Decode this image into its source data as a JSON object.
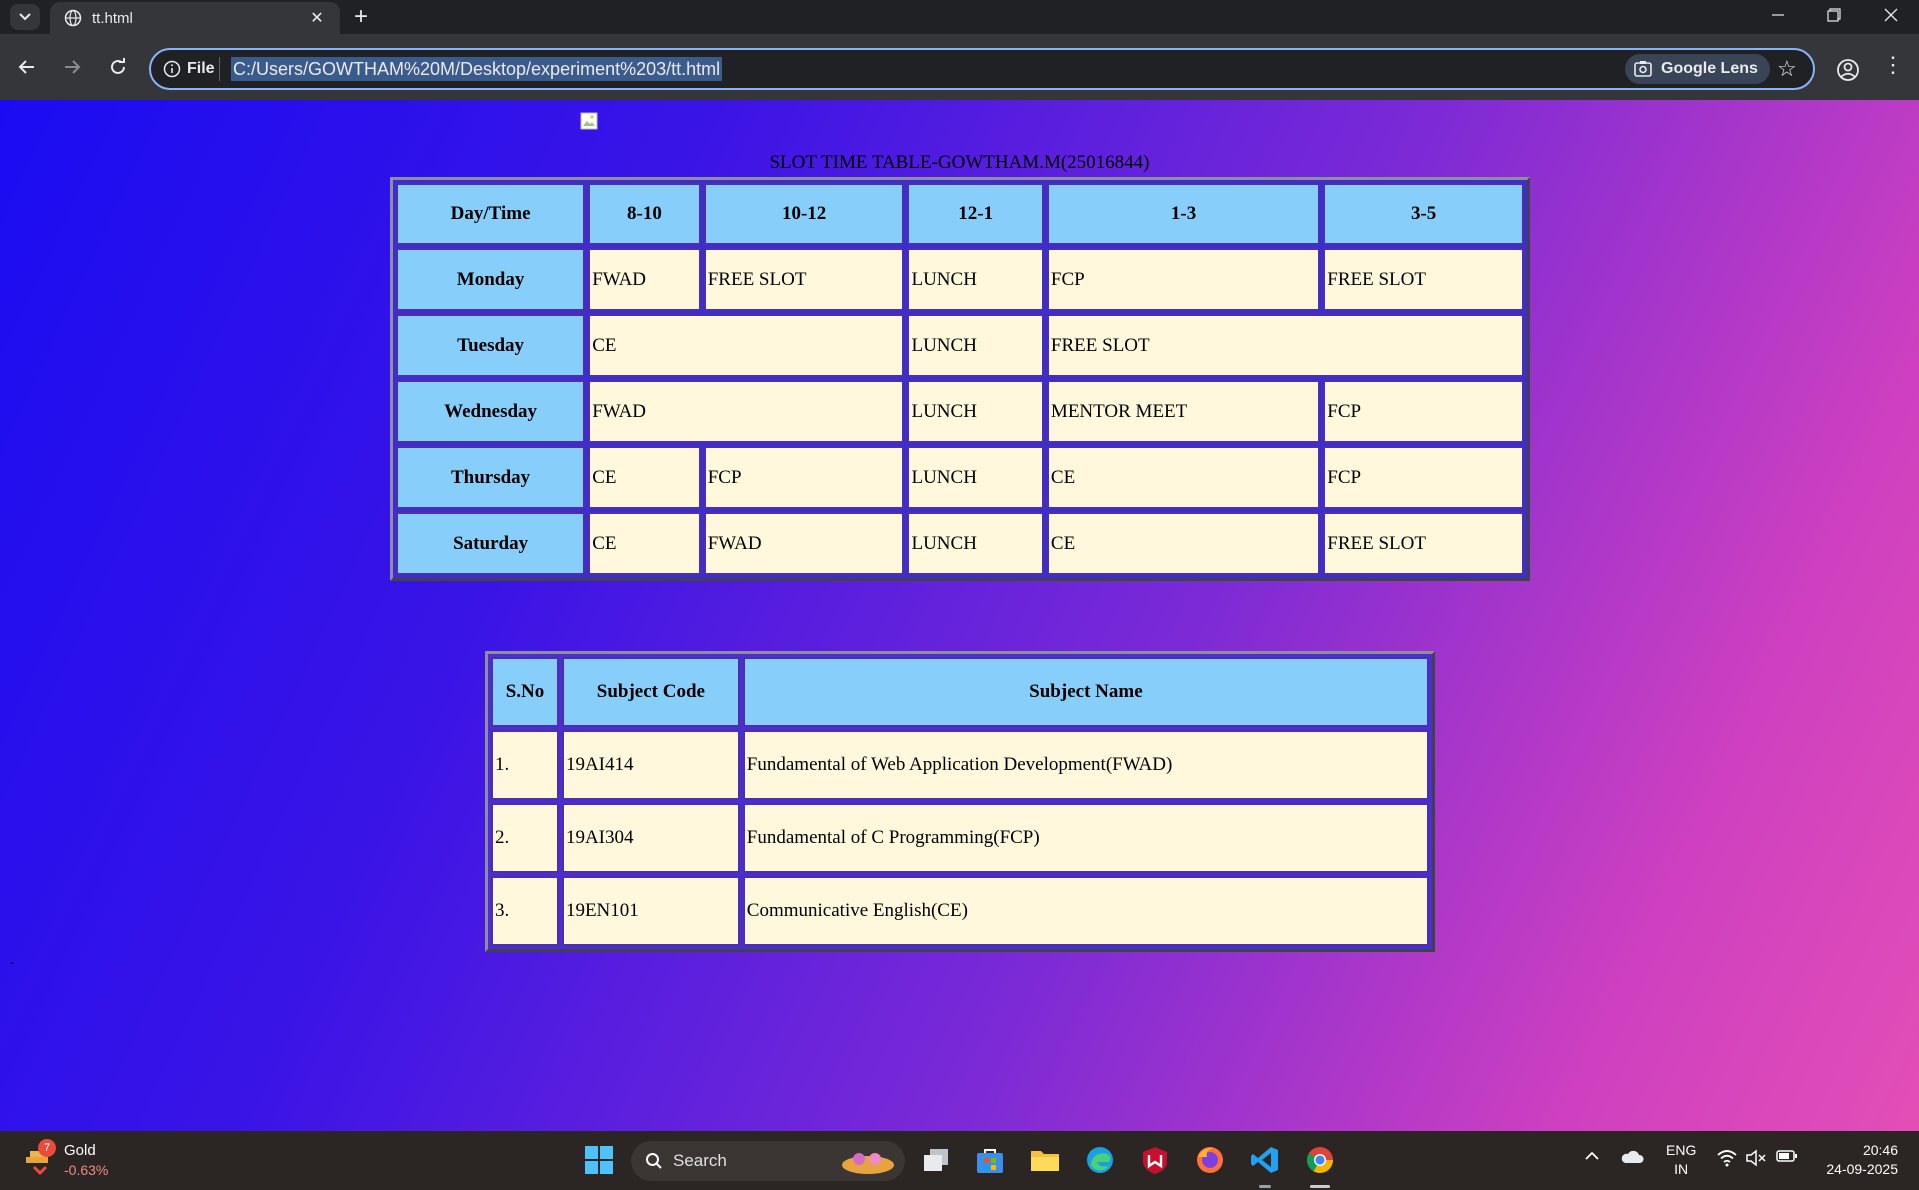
{
  "browser": {
    "tab_title": "tt.html",
    "tab_close": "✕",
    "new_tab": "+",
    "omnibox_scheme": "File",
    "url": "C:/Users/GOWTHAM%20M/Desktop/experiment%203/tt.html",
    "lens_label": "Google Lens",
    "accent_color": "#8ab4f8"
  },
  "page": {
    "caption": "SLOT TIME TABLE-GOWTHAM.M(25016844)",
    "timetable": {
      "headers": [
        "Day/Time",
        "8-10",
        "10-12",
        "12-1",
        "1-3",
        "3-5"
      ],
      "rows": [
        {
          "day": "Monday",
          "cells": [
            "FWAD",
            "FREE SLOT",
            "LUNCH",
            "FCP",
            "FREE SLOT"
          ]
        },
        {
          "day": "Tuesday",
          "cells": [
            "CE",
            "LUNCH",
            "FREE SLOT"
          ]
        },
        {
          "day": "Wednesday",
          "cells": [
            "FWAD",
            "LUNCH",
            "MENTOR MEET",
            "FCP"
          ]
        },
        {
          "day": "Thursday",
          "cells": [
            "CE",
            "FCP",
            "LUNCH",
            "CE",
            "FCP"
          ]
        },
        {
          "day": "Saturday",
          "cells": [
            "CE",
            "FWAD",
            "LUNCH",
            "CE",
            "FREE SLOT"
          ]
        }
      ]
    },
    "subjects": {
      "headers": [
        "S.No",
        "Subject Code",
        "Subject Name"
      ],
      "rows": [
        {
          "sno": "1.",
          "code": "19AI414",
          "name": "Fundamental of Web Application Development(FWAD)"
        },
        {
          "sno": "2.",
          "code": "19AI304",
          "name": "Fundamental of C Programming(FCP)"
        },
        {
          "sno": "3.",
          "code": "19EN101",
          "name": "Communicative English(CE)"
        }
      ]
    },
    "stray_mark": "-"
  },
  "taskbar": {
    "widget_badge": "7",
    "widget_name": "Gold",
    "widget_change": "-0.63%",
    "search_label": "Search",
    "lang_line1": "ENG",
    "lang_line2": "IN",
    "time": "20:46",
    "date": "24-09-2025"
  }
}
